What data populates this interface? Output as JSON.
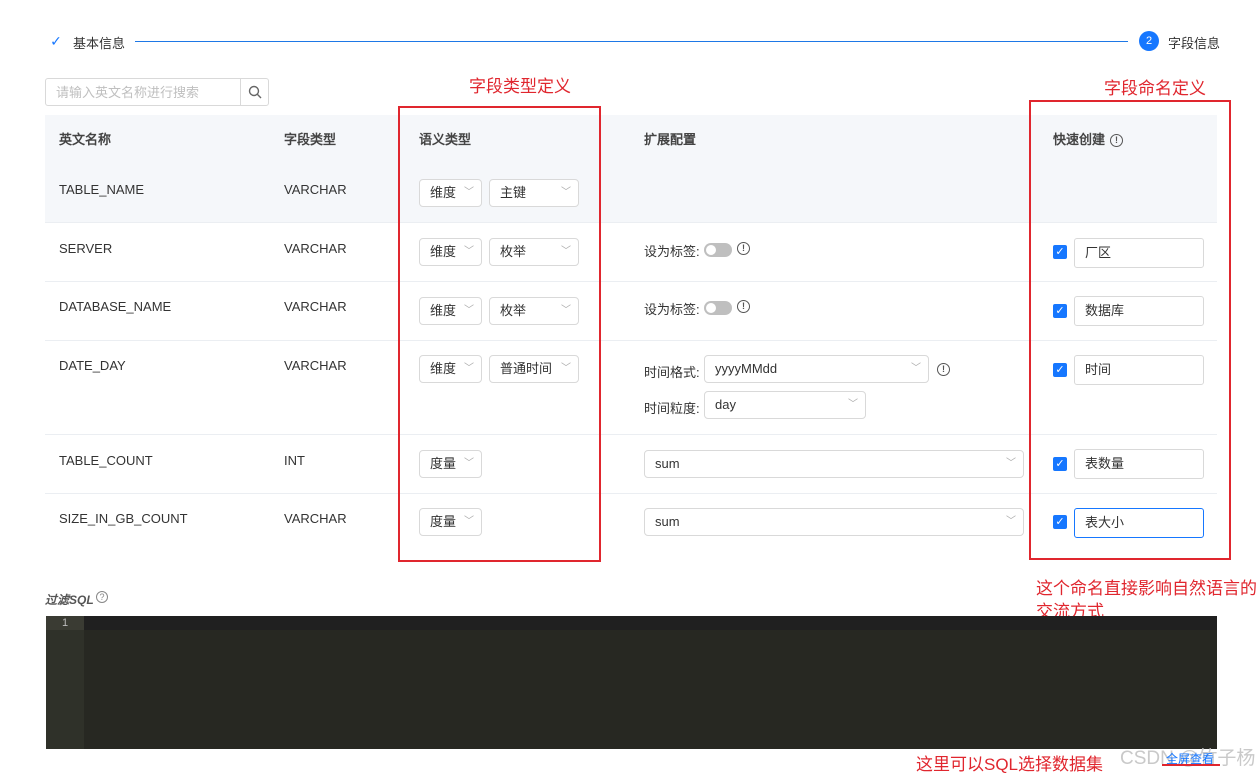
{
  "steps": [
    {
      "label": "基本信息",
      "status": "done"
    },
    {
      "label": "字段信息",
      "status": "active",
      "number": "2"
    }
  ],
  "search": {
    "placeholder": "请输入英文名称进行搜索"
  },
  "table": {
    "headers": [
      "英文名称",
      "字段类型",
      "语义类型",
      "扩展配置",
      "快速创建"
    ],
    "rows": [
      {
        "name": "TABLE_NAME",
        "type": "VARCHAR",
        "semantic": "维度",
        "subtype": "主键"
      },
      {
        "name": "SERVER",
        "type": "VARCHAR",
        "semantic": "维度",
        "subtype": "枚举",
        "tag_label": "设为标签:",
        "tag_on": false,
        "checked": true,
        "alias": "厂区"
      },
      {
        "name": "DATABASE_NAME",
        "type": "VARCHAR",
        "semantic": "维度",
        "subtype": "枚举",
        "tag_label": "设为标签:",
        "tag_on": false,
        "checked": true,
        "alias": "数据库"
      },
      {
        "name": "DATE_DAY",
        "type": "VARCHAR",
        "semantic": "维度",
        "subtype": "普通时间",
        "time_format_label": "时间格式:",
        "time_format": "yyyyMMdd",
        "time_grain_label": "时间粒度:",
        "time_grain": "day",
        "checked": true,
        "alias": "时间"
      },
      {
        "name": "TABLE_COUNT",
        "type": "INT",
        "semantic": "度量",
        "agg": "sum",
        "checked": true,
        "alias": "表数量"
      },
      {
        "name": "SIZE_IN_GB_COUNT",
        "type": "VARCHAR",
        "semantic": "度量",
        "agg": "sum",
        "checked": true,
        "alias": "表大小"
      }
    ]
  },
  "sql": {
    "label": "过滤SQL",
    "line": "1"
  },
  "fullscreen_label": "全屏查看",
  "annotations": {
    "type_def": "字段类型定义",
    "name_def": "字段命名定义",
    "name_note_1": "这个命名直接影响自然语言的",
    "name_note_2": "交流方式",
    "sql_note": "这里可以SQL选择数据集"
  },
  "watermark": "CSDN @竹子杨",
  "colors": {
    "primary": "#1677ff",
    "annotation": "#e0262e",
    "editor_bg": "#272822"
  }
}
